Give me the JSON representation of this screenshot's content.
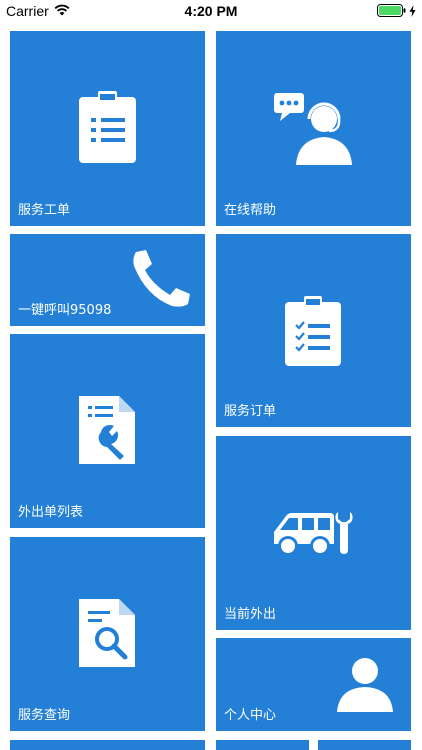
{
  "status_bar": {
    "carrier": "Carrier",
    "time": "4:20 PM"
  },
  "tiles": {
    "service_work_order": "服务工单",
    "online_help": "在线帮助",
    "one_key_call": "一键呼叫95098",
    "service_order": "服务订单",
    "dispatch_list": "外出单列表",
    "current_dispatch": "当前外出",
    "service_query": "服务查询",
    "personal_center": "个人中心"
  },
  "colors": {
    "tile_blue": "#2380d6",
    "battery_green": "#4cd964"
  },
  "icons": {
    "service_work_order": "clipboard-list-icon",
    "online_help": "customer-service-agent-icon",
    "one_key_call": "phone-handset-icon",
    "service_order": "clipboard-checklist-icon",
    "dispatch_list": "document-wrench-icon",
    "current_dispatch": "van-wrench-icon",
    "service_query": "document-search-icon",
    "personal_center": "user-silhouette-icon"
  }
}
